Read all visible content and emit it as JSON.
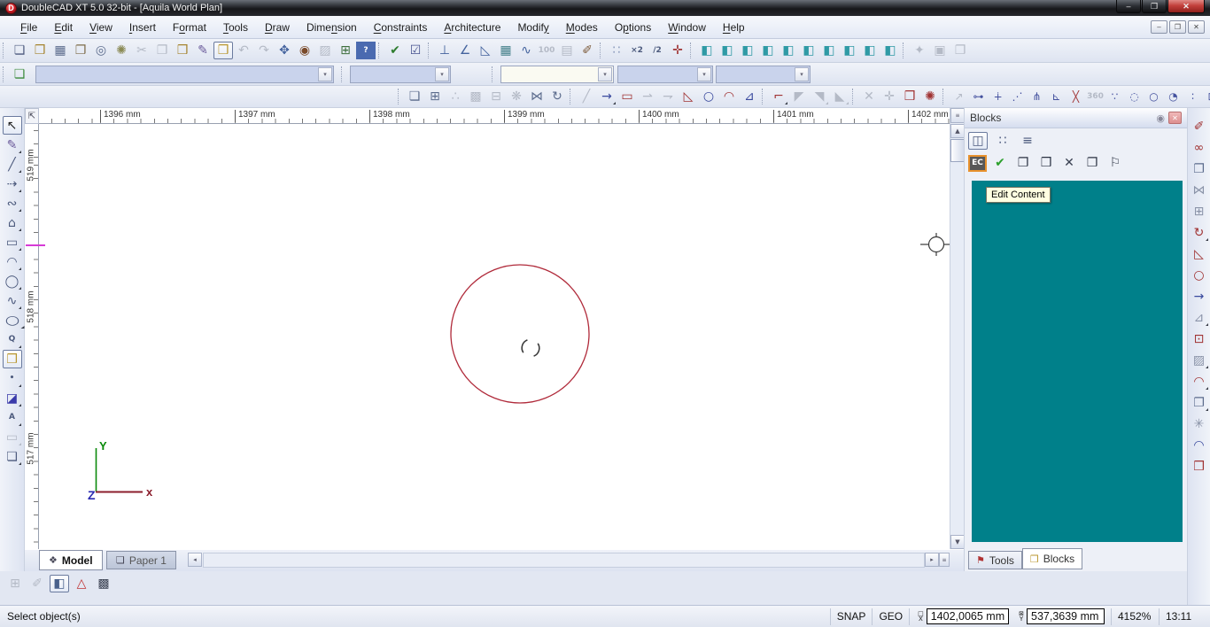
{
  "window": {
    "title": "DoubleCAD XT 5.0 32-bit - [Aquila World Plan]",
    "app_icon_letter": "D",
    "controls": [
      {
        "n": "minimize-button",
        "g": "–"
      },
      {
        "n": "restore-button",
        "g": "❐"
      },
      {
        "n": "close-button",
        "g": "✕"
      }
    ],
    "mdi_controls": [
      {
        "n": "mdi-minimize-button",
        "g": "–"
      },
      {
        "n": "mdi-restore-button",
        "g": "❐"
      },
      {
        "n": "mdi-close-button",
        "g": "✕"
      }
    ]
  },
  "menu": {
    "items": [
      {
        "t": "File",
        "u": 0
      },
      {
        "t": "Edit",
        "u": 0
      },
      {
        "t": "View",
        "u": 0
      },
      {
        "t": "Insert",
        "u": 0
      },
      {
        "t": "Format",
        "u": 1
      },
      {
        "t": "Tools",
        "u": 0
      },
      {
        "t": "Draw",
        "u": 0
      },
      {
        "t": "Dimension",
        "u": 4
      },
      {
        "t": "Constraints",
        "u": 0
      },
      {
        "t": "Architecture",
        "u": 0
      },
      {
        "t": "Modify",
        "u": 5
      },
      {
        "t": "Modes",
        "u": 0
      },
      {
        "t": "Options",
        "u": 1
      },
      {
        "t": "Window",
        "u": 0
      },
      {
        "t": "Help",
        "u": 0
      }
    ]
  },
  "icons": {
    "dropdown": "▾",
    "up": "▲",
    "down": "▼",
    "left": "◂",
    "right": "▸",
    "ruler_origin": "⇱",
    "splitter": "≡"
  },
  "toolbars": {
    "tb2_icon": "❏",
    "tb1g1": [
      {
        "n": "new-file",
        "g": "❏"
      },
      {
        "n": "open-file",
        "g": "❒",
        "c": "#a5842f"
      },
      {
        "n": "save-file",
        "g": "▦",
        "c": "#5b6b8c"
      },
      {
        "n": "publish",
        "g": "❐",
        "c": "#7d6b49"
      },
      {
        "n": "print-preview",
        "g": "◎",
        "c": "#5b6b8c"
      },
      {
        "n": "settings-gear",
        "g": "✺",
        "c": "#8a8a55"
      },
      {
        "n": "cut",
        "g": "✂",
        "d": 1
      },
      {
        "n": "copy",
        "g": "❐",
        "d": 1
      },
      {
        "n": "paste",
        "g": "❒",
        "c": "#a5842f"
      },
      {
        "n": "format-painter",
        "g": "✎",
        "c": "#6a5a9a"
      },
      {
        "n": "edit-content-mode",
        "g": "❒",
        "c": "#b8962e",
        "p": 1
      },
      {
        "n": "undo",
        "g": "↶",
        "d": 1
      },
      {
        "n": "redo",
        "g": "↷",
        "d": 1
      },
      {
        "n": "pan",
        "g": "✥",
        "c": "#44639e"
      },
      {
        "n": "zoom-previous",
        "g": "◉",
        "c": "#7a4a2a"
      },
      {
        "n": "render",
        "g": "▨",
        "d": 1
      },
      {
        "n": "calculator",
        "g": "⊞",
        "c": "#3c6e3c"
      },
      {
        "n": "help",
        "g": "?",
        "cls": "txt",
        "c": "#ffffff",
        "bg": "#4a6ab0"
      }
    ],
    "tb1g2": [
      {
        "n": "spell-check",
        "g": "✔",
        "c": "#2f7d2f"
      },
      {
        "n": "check-drawing",
        "g": "☑",
        "c": "#44508e"
      }
    ],
    "tb1g3": [
      {
        "n": "coordinate-system",
        "g": "⊥",
        "c": "#44639e"
      },
      {
        "n": "inspect-vector",
        "g": "∠",
        "c": "#44639e"
      },
      {
        "n": "inspect-angle",
        "g": "◺",
        "c": "#44639e"
      },
      {
        "n": "grid-options",
        "g": "▦",
        "c": "#44808a"
      },
      {
        "n": "inspect-curve",
        "g": "∿",
        "c": "#44639e"
      },
      {
        "n": "dimension-display",
        "g": "100",
        "cls": "txt",
        "d": 1
      },
      {
        "n": "hatch-bricks",
        "g": "▤",
        "d": 1
      },
      {
        "n": "marker-pen",
        "g": "✐",
        "c": "#7d5b3a"
      }
    ],
    "tb1g4": [
      {
        "n": "grid-dots",
        "g": "∷",
        "c": "#8899bb"
      },
      {
        "n": "grid-double",
        "g": "×2",
        "cls": "txt"
      },
      {
        "n": "grid-half",
        "g": "/2",
        "cls": "txt"
      },
      {
        "n": "grid-origin",
        "g": "✛",
        "c": "#a03333"
      }
    ],
    "tb1g5": [
      {
        "n": "workplane-by-entity",
        "g": "◧",
        "c": "#2f9aa5"
      },
      {
        "n": "workplane-top",
        "g": "◧",
        "c": "#2f9aa5"
      },
      {
        "n": "workplane-front",
        "g": "◧",
        "c": "#2f9aa5"
      },
      {
        "n": "workplane-left",
        "g": "◧",
        "c": "#2f9aa5"
      },
      {
        "n": "workplane-right",
        "g": "◧",
        "c": "#2f9aa5"
      },
      {
        "n": "workplane-back",
        "g": "◧",
        "c": "#2f9aa5"
      },
      {
        "n": "view-iso-ne",
        "g": "◧",
        "c": "#2f9aa5"
      },
      {
        "n": "view-iso-nw",
        "g": "◧",
        "c": "#2f9aa5"
      },
      {
        "n": "view-iso-se",
        "g": "◧",
        "c": "#2f9aa5"
      },
      {
        "n": "view-iso-sw",
        "g": "◧",
        "c": "#2f9aa5"
      }
    ],
    "tb1g6": [
      {
        "n": "light-tool",
        "g": "✦",
        "d": 1
      },
      {
        "n": "selection-box",
        "g": "▣",
        "d": 1
      },
      {
        "n": "extract-copy",
        "g": "❐",
        "d": 1
      }
    ],
    "tb3gA": [
      {
        "n": "stack-pages",
        "g": "❏",
        "c": "#5b6b8c"
      },
      {
        "n": "tile-view",
        "g": "⊞",
        "c": "#5b6b8c"
      },
      {
        "n": "point-options",
        "g": "∴",
        "d": 1
      },
      {
        "n": "pattern-fill",
        "g": "▩",
        "d": 1
      },
      {
        "n": "tile-pair",
        "g": "⊟",
        "d": 1
      },
      {
        "n": "radial-array",
        "g": "❋",
        "d": 1
      },
      {
        "n": "mirror",
        "g": "⋈",
        "c": "#5b6b8c"
      },
      {
        "n": "rotate-copy",
        "g": "↻",
        "c": "#5b6b8c"
      }
    ],
    "tb3gB": [
      {
        "n": "line",
        "g": "╱",
        "d": 1
      },
      {
        "n": "polyline",
        "g": "→",
        "c": "#3a4a9e",
        "fly": 1
      },
      {
        "n": "modify-rect",
        "g": "▭",
        "c": "#a03333"
      },
      {
        "n": "trim",
        "g": "⇀",
        "d": 1
      },
      {
        "n": "extend",
        "g": "⇁",
        "d": 1
      },
      {
        "n": "set-square",
        "g": "◺",
        "c": "#a03333"
      },
      {
        "n": "circle",
        "g": "○",
        "c": "#3a4a9e"
      },
      {
        "n": "arc",
        "g": "◠",
        "c": "#a03333"
      },
      {
        "n": "polygon",
        "g": "⊿",
        "c": "#3a4a9e"
      }
    ],
    "tb3gC": [
      {
        "n": "fillet",
        "g": "⌐",
        "c": "#a03333",
        "fly": 1
      },
      {
        "n": "chamfer",
        "g": "◤",
        "d": 1
      },
      {
        "n": "corner-meet",
        "g": "◥",
        "d": 1,
        "fly": 1
      },
      {
        "n": "corner-split",
        "g": "◣",
        "d": 1,
        "fly": 1
      }
    ],
    "tb3gD": [
      {
        "n": "divide-cross",
        "g": "✕",
        "d": 1
      },
      {
        "n": "align-nodes",
        "g": "✛",
        "d": 1
      },
      {
        "n": "print-region",
        "g": "❒",
        "c": "#a03333"
      },
      {
        "n": "center-mark",
        "g": "✺",
        "c": "#a03333"
      }
    ],
    "tb3gE": [
      {
        "n": "snap-free",
        "g": "↗",
        "cls": "sm",
        "d": 1
      },
      {
        "n": "snap-midpoint",
        "g": "⊶",
        "cls": "sm"
      },
      {
        "n": "snap-endpoint",
        "g": "∔",
        "cls": "sm"
      },
      {
        "n": "snap-nearest",
        "g": "⋰",
        "cls": "sm"
      },
      {
        "n": "snap-intersection",
        "g": "⋔",
        "cls": "sm"
      },
      {
        "n": "snap-perpendicular",
        "g": "⊾",
        "cls": "sm"
      },
      {
        "n": "snap-cross",
        "g": "╳",
        "cls": "sm",
        "c": "#a03333"
      },
      {
        "n": "snap-360",
        "g": "360",
        "cls": "txt sm",
        "d": 1
      },
      {
        "n": "snap-node",
        "g": "∵",
        "cls": "sm"
      },
      {
        "n": "snap-center",
        "g": "◌",
        "cls": "sm"
      },
      {
        "n": "snap-arc-center",
        "g": "○",
        "cls": "sm"
      },
      {
        "n": "snap-quadrant",
        "g": "◔",
        "cls": "sm"
      },
      {
        "n": "snap-vertex",
        "g": "∶",
        "cls": "sm"
      },
      {
        "n": "snap-grid-point",
        "g": "⊡",
        "cls": "sm"
      }
    ],
    "left": [
      {
        "n": "select-tool",
        "g": "↖",
        "p": 1,
        "c": "#222222"
      },
      {
        "n": "sketch-tool",
        "g": "✎",
        "fly": 1,
        "c": "#6a5a9a"
      },
      {
        "n": "line-tool",
        "g": "╱",
        "fly": 1
      },
      {
        "n": "construction-tool",
        "g": "⇢",
        "fly": 1
      },
      {
        "n": "polyline-tool",
        "g": "∾",
        "fly": 1
      },
      {
        "n": "polygon-tool",
        "g": "⌂",
        "fly": 1
      },
      {
        "n": "rectangle-tool",
        "g": "▭",
        "fly": 1
      },
      {
        "n": "arc-tool",
        "g": "◠",
        "fly": 1
      },
      {
        "n": "circle-tool",
        "g": "◯",
        "fly": 1
      },
      {
        "n": "spline-tool",
        "g": "∿",
        "fly": 1
      },
      {
        "n": "ellipse-tool",
        "g": "○",
        "cls": "wide",
        "fly": 1
      },
      {
        "n": "zoom-tool",
        "g": "Q",
        "cls": "txt",
        "fly": 1
      },
      {
        "n": "edit-content-tool",
        "g": "❒",
        "c": "#b8962e",
        "p": 1
      },
      {
        "n": "point-tool",
        "g": "•",
        "cls": "txt",
        "fly": 1
      },
      {
        "n": "hatch-tool",
        "g": "◪",
        "c": "#3a3aaa",
        "fly": 1
      },
      {
        "n": "text-tool",
        "g": "A",
        "cls": "txt",
        "fly": 1
      },
      {
        "n": "dimension-tool",
        "g": "▭",
        "d": 1,
        "fly": 1
      },
      {
        "n": "viewport-tool",
        "g": "❏",
        "fly": 1
      }
    ],
    "right": [
      {
        "n": "edit-eraser",
        "g": "✐",
        "c": "#a03333"
      },
      {
        "n": "copy-circles",
        "g": "∞",
        "c": "#a03333"
      },
      {
        "n": "duplicate-entity",
        "g": "❐",
        "c": "#5b6b8c"
      },
      {
        "n": "mirror-entity",
        "g": "⋈",
        "c": "#8a93a8"
      },
      {
        "n": "array-entity",
        "g": "⊞",
        "c": "#8a93a8"
      },
      {
        "n": "rotate-entity",
        "g": "↻",
        "c": "#a03333",
        "fly": 1
      },
      {
        "n": "set-square-entity",
        "g": "◺",
        "c": "#a03333"
      },
      {
        "n": "circle-entity",
        "g": "○",
        "c": "#a03333"
      },
      {
        "n": "polyline-entity",
        "g": "→",
        "c": "#3a4a9e"
      },
      {
        "n": "polygon-entity",
        "g": "⊿",
        "c": "#8a93a8",
        "fly": 1
      },
      {
        "n": "image-attach",
        "g": "⊡",
        "c": "#a03333"
      },
      {
        "n": "hatch-entity",
        "g": "▨",
        "c": "#8a93a8",
        "fly": 1
      },
      {
        "n": "fillet-entity",
        "g": "◠",
        "c": "#a03333",
        "fly": 1
      },
      {
        "n": "group-copy",
        "g": "❐",
        "c": "#5b6b8c",
        "fly": 1
      },
      {
        "n": "explode-entity",
        "g": "✳",
        "c": "#8a93a8"
      },
      {
        "n": "arc-entity",
        "g": "◠",
        "c": "#3a4a9e"
      },
      {
        "n": "print-entity",
        "g": "❒",
        "c": "#a03333"
      }
    ],
    "bottom_modes": [
      {
        "n": "layout-mode",
        "g": "⊞",
        "d": 1
      },
      {
        "n": "transform-mode",
        "g": "✐",
        "d": 1
      },
      {
        "n": "draft-render-mode",
        "g": "◧",
        "p": 1,
        "c": "#49618c"
      },
      {
        "n": "degrade-warning",
        "g": "△",
        "c": "#c03333"
      },
      {
        "n": "render-finish",
        "g": "▩",
        "c": "#3a4152"
      }
    ]
  },
  "property_bar": {
    "combo_values": [
      "",
      "",
      "",
      "",
      ""
    ]
  },
  "rulers": {
    "h": [
      "1396 mm",
      "1397 mm",
      "1398 mm",
      "1399 mm",
      "1400 mm",
      "1401 mm",
      "1402 mm"
    ],
    "v": [
      "519 mm",
      "518 mm",
      "517 mm"
    ]
  },
  "canvas": {
    "axis": {
      "y": "Y",
      "x": "x",
      "z": "Z"
    }
  },
  "colors": {
    "circle": "#b02a3a",
    "teal_panel": "#00808a",
    "tooltip_bg": "#ffffe1",
    "ec_highlight": "#e8912d",
    "axis_y": "#0a8a0a",
    "axis_x": "#8b1e2d",
    "axis_z": "#2a2ab0",
    "magenta_mark": "#d63ad6"
  },
  "blocks_panel": {
    "title": "Blocks",
    "pin_icon": "◉",
    "close_icon": "✕",
    "tooltip": "Edit Content",
    "view_modes": [
      {
        "n": "view-thumbnails",
        "g": "◫",
        "p": 1
      },
      {
        "n": "view-list",
        "g": "∷"
      },
      {
        "n": "view-details",
        "g": "≡"
      }
    ],
    "tools": [
      {
        "n": "edit-content-button",
        "g": "EC",
        "cls": "ec"
      },
      {
        "n": "confirm-edits",
        "g": "✔",
        "c": "#2ca02c"
      },
      {
        "n": "copy-block",
        "g": "❐",
        "c": "#2a3142"
      },
      {
        "n": "save-block",
        "g": "❒",
        "c": "#2a3142"
      },
      {
        "n": "delete-block",
        "g": "✕",
        "c": "#3a4152"
      },
      {
        "n": "copy-from-drawing",
        "g": "❐",
        "c": "#2a3142"
      },
      {
        "n": "tag-block",
        "g": "⚐",
        "c": "#2a3142"
      }
    ],
    "tabs": [
      {
        "label": "Tools",
        "icon": "⚑"
      },
      {
        "label": "Blocks",
        "icon": "❒"
      }
    ]
  },
  "doc_tabs": [
    {
      "label": "Model",
      "icon": "❖"
    },
    {
      "label": "Paper 1",
      "icon": "❏"
    }
  ],
  "status": {
    "message": "Select object(s)",
    "snap": "SNAP",
    "geo": "GEO",
    "x_icon_top": "□",
    "x_icon_letter": "X",
    "x_value": "1402,0065 mm",
    "y_icon_top": "⊠",
    "y_icon_letter": "Y",
    "y_value": "537,3639 mm",
    "zoom": "4152%",
    "time": "13:11"
  }
}
